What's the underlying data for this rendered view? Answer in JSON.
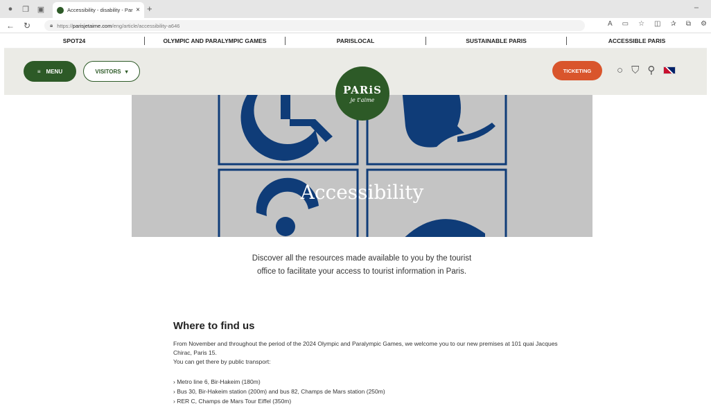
{
  "browser": {
    "tab_title": "Accessibility - disability - Paris - ",
    "url_scheme": "https://",
    "url_host": "parisjetaime.com",
    "url_path": "/eng/article/accessibility-a646"
  },
  "topnav": {
    "items": [
      "SPOT24",
      "OLYMPIC AND PARALYMPIC GAMES",
      "PARISLOCAL",
      "SUSTAINABLE PARIS",
      "ACCESSIBLE PARIS"
    ]
  },
  "header": {
    "menu_label": "MENU",
    "visitors_label": "VISITORS",
    "ticketing_label": "TICKETING",
    "logo_line1": "PARiS",
    "logo_line2": "je t'aime"
  },
  "hero": {
    "title": "Accessibility"
  },
  "intro": "Discover all the resources made available to you by the tourist office to facilitate your access to tourist information in Paris.",
  "where": {
    "heading": "Where to find us",
    "paragraph1": "From November and throughout the period of the 2024 Olympic and Paralympic Games, we welcome you to our new premises at 101 quai Jacques Chirac, Paris 15.",
    "paragraph2": "You can get there by public transport:",
    "transport": [
      "Metro line 6, Bir-Hakeim (180m)",
      "Bus 30, Bir-Hakeim station (200m) and bus 82, Champs de Mars station (250m)",
      "RER C, Champs de Mars Tour Eiffel (350m)"
    ]
  },
  "colors": {
    "brand_green": "#2d5a27",
    "ticket_orange": "#d9552c",
    "header_bg": "#ebebe6",
    "hero_bg": "#c4c4c4",
    "pictogram_blue": "#0f3c78"
  }
}
